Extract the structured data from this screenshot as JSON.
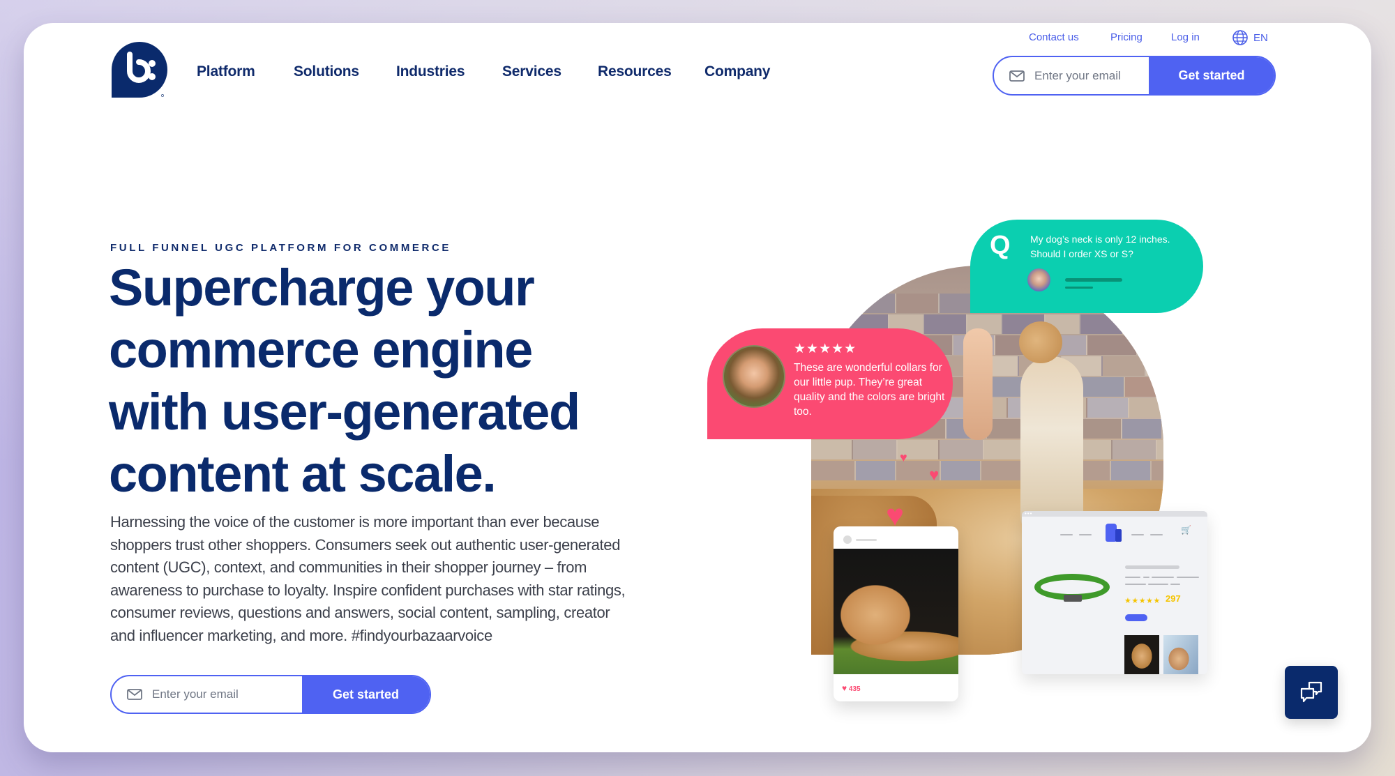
{
  "brand": {
    "logo_icon": "bazaarvoice-b-logo",
    "colors": {
      "navy": "#0a2a6c",
      "primary": "#4f62f2",
      "pink": "#fb4a72",
      "teal": "#0bcfb0",
      "gold": "#f5c400"
    }
  },
  "header": {
    "nav": [
      {
        "label": "Platform"
      },
      {
        "label": "Solutions"
      },
      {
        "label": "Industries"
      },
      {
        "label": "Services"
      },
      {
        "label": "Resources"
      },
      {
        "label": "Company"
      }
    ],
    "utility_links": [
      {
        "label": "Contact us"
      },
      {
        "label": "Pricing"
      },
      {
        "label": "Log in"
      }
    ],
    "language": {
      "icon": "globe-icon",
      "label": "EN"
    },
    "email_form": {
      "placeholder": "Enter your email",
      "value": "",
      "icon": "mail-icon",
      "button_label": "Get started"
    }
  },
  "hero": {
    "eyebrow": "FULL FUNNEL UGC PLATFORM FOR COMMERCE",
    "headline_lines": [
      "Supercharge your",
      "commerce engine",
      "with user-generated",
      "content at scale."
    ],
    "body_lines": [
      "Harnessing the voice of the customer is more important than ever because",
      "shoppers trust other shoppers. Consumers seek out authentic user-generated",
      "content (UGC), context, and communities in their shopper journey – from",
      "awareness to purchase to loyalty. Inspire confident purchases with star ratings,",
      "consumer reviews, questions and answers, social content, sampling, creator",
      "and influencer marketing, and more. #findyourbazaarvoice"
    ],
    "email_form": {
      "placeholder": "Enter your email",
      "value": "",
      "icon": "mail-icon",
      "button_label": "Get started"
    }
  },
  "collage": {
    "review_bubble": {
      "rating": 5,
      "stars": "★★★★★",
      "text": "These are wonderful collars for our little pup. They’re great quality and the colors are bright too."
    },
    "qa_bubble": {
      "icon_letter": "Q",
      "question": "My dog’s neck is only 12 inches. Should I order XS or S?"
    },
    "social_post": {
      "likes": "435"
    },
    "product_card": {
      "stars": "★★★★★",
      "rating": 5,
      "review_count": "297"
    }
  },
  "chat_button": {
    "icon": "chat-bubbles-icon"
  }
}
